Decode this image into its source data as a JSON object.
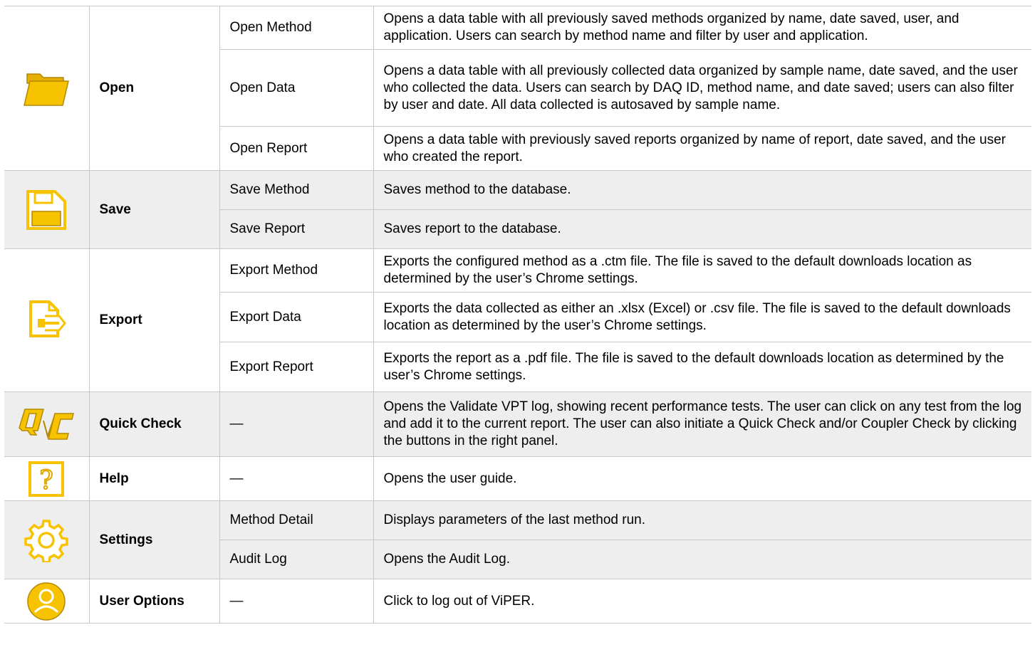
{
  "colors": {
    "icon_fill": "#f7c300",
    "icon_stroke": "#b38900",
    "row_shade": "#eeeeee",
    "border": "#c8c8c8"
  },
  "rows": [
    {
      "icon": "folder-icon",
      "name": "Open",
      "items": [
        {
          "sub": "Open Method",
          "desc": "Opens a data table with all previously saved methods organized by name, date saved, user, and application. Users can search by method name and filter by user and application."
        },
        {
          "sub": "Open Data",
          "desc": "Opens a data table with all previously collected data organized by sample name, date saved, and the user who collected the data. Users can search by DAQ ID, method name, and date saved; users can also filter by user and date. All data collected is autosaved by sample name."
        },
        {
          "sub": "Open Report",
          "desc": "Opens a data table with previously saved reports organized by name of report, date saved, and the user who created the report."
        }
      ]
    },
    {
      "icon": "save-icon",
      "name": "Save",
      "items": [
        {
          "sub": "Save Method",
          "desc": "Saves method to the database."
        },
        {
          "sub": "Save Report",
          "desc": "Saves report to the database."
        }
      ]
    },
    {
      "icon": "export-icon",
      "name": "Export",
      "items": [
        {
          "sub": "Export Method",
          "desc": "Exports the configured method as a .ctm file. The file is saved to the default downloads location as determined by the user’s Chrome settings."
        },
        {
          "sub": "Export Data",
          "desc": "Exports the data collected as either an .xlsx (Excel) or .csv file. The file is saved to the default downloads location as determined by the user’s Chrome settings."
        },
        {
          "sub": "Export Report",
          "desc": "Exports the report as a .pdf file. The file is saved to the default downloads location as determined by the user’s Chrome settings."
        }
      ]
    },
    {
      "icon": "quick-check-icon",
      "name": "Quick Check",
      "items": [
        {
          "sub": "—",
          "desc": "Opens the Validate VPT log, showing recent performance tests. The user can click on any test from the log and add it to the current report. The user can also initiate a Quick Check and/or Coupler Check by clicking the buttons in the right panel."
        }
      ]
    },
    {
      "icon": "help-icon",
      "name": "Help",
      "items": [
        {
          "sub": "—",
          "desc": "Opens the user guide."
        }
      ]
    },
    {
      "icon": "gear-icon",
      "name": "Settings",
      "items": [
        {
          "sub": "Method Detail",
          "desc": "Displays parameters of the last method run."
        },
        {
          "sub": "Audit Log",
          "desc": "Opens the Audit Log."
        }
      ]
    },
    {
      "icon": "user-icon",
      "name": "User Options",
      "items": [
        {
          "sub": "—",
          "desc": "Click to log out of ViPER."
        }
      ]
    }
  ]
}
